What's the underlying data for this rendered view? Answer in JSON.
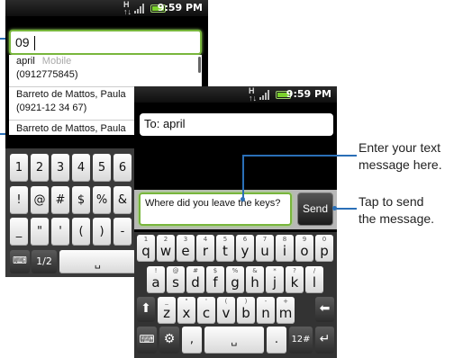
{
  "status_bar": {
    "time": "9:59 PM"
  },
  "screen1": {
    "input_value": "09",
    "suggestions": [
      {
        "name": "april",
        "type": "Mobile",
        "number": "(0912775845)"
      },
      {
        "name": "Barreto de Mattos, Paula",
        "number": "(0921-12 34 67)"
      },
      {
        "name": "Barreto de Mattos, Paula"
      }
    ],
    "keypad": {
      "row1": [
        "1",
        "2",
        "3",
        "4",
        "5",
        "6"
      ],
      "row2": [
        "!",
        "@",
        "#",
        "$",
        "%",
        "&"
      ],
      "row3": [
        "_",
        "\"",
        "'",
        "(",
        ")",
        "-"
      ],
      "page_label": "1/2"
    }
  },
  "screen2": {
    "to_field": "To: april",
    "message": "Where did you leave the keys?",
    "send_label": "Send",
    "keyboard": {
      "row1": [
        {
          "sup": "1",
          "key": "q"
        },
        {
          "sup": "2",
          "key": "w"
        },
        {
          "sup": "3",
          "key": "e"
        },
        {
          "sup": "4",
          "key": "r"
        },
        {
          "sup": "5",
          "key": "t"
        },
        {
          "sup": "6",
          "key": "y"
        },
        {
          "sup": "7",
          "key": "u"
        },
        {
          "sup": "8",
          "key": "i"
        },
        {
          "sup": "9",
          "key": "o"
        },
        {
          "sup": "0",
          "key": "p"
        }
      ],
      "row2": [
        {
          "sup": "!",
          "key": "a"
        },
        {
          "sup": "@",
          "key": "s"
        },
        {
          "sup": "#",
          "key": "d"
        },
        {
          "sup": "$",
          "key": "f"
        },
        {
          "sup": "%",
          "key": "g"
        },
        {
          "sup": "&",
          "key": "h"
        },
        {
          "sup": "*",
          "key": "j"
        },
        {
          "sup": "?",
          "key": "k"
        },
        {
          "sup": "/",
          "key": "l"
        }
      ],
      "row3": [
        {
          "sup": "_",
          "key": "z"
        },
        {
          "sup": "\"",
          "key": "x"
        },
        {
          "sup": "'",
          "key": "c"
        },
        {
          "sup": "(",
          "key": "v"
        },
        {
          "sup": ")",
          "key": "b"
        },
        {
          "sup": "-",
          "key": "n"
        },
        {
          "sup": "+",
          "key": "m"
        }
      ],
      "row4": {
        "comma": ",",
        "period": ".",
        "numkey": "12#"
      }
    }
  },
  "callouts": {
    "text_hint_1": "Enter your text",
    "text_hint_2": "message here.",
    "send_hint_1": "Tap to send",
    "send_hint_2": "the message."
  },
  "colors": {
    "focus_green": "#78b63c",
    "callout_blue": "#2a6fb7"
  }
}
